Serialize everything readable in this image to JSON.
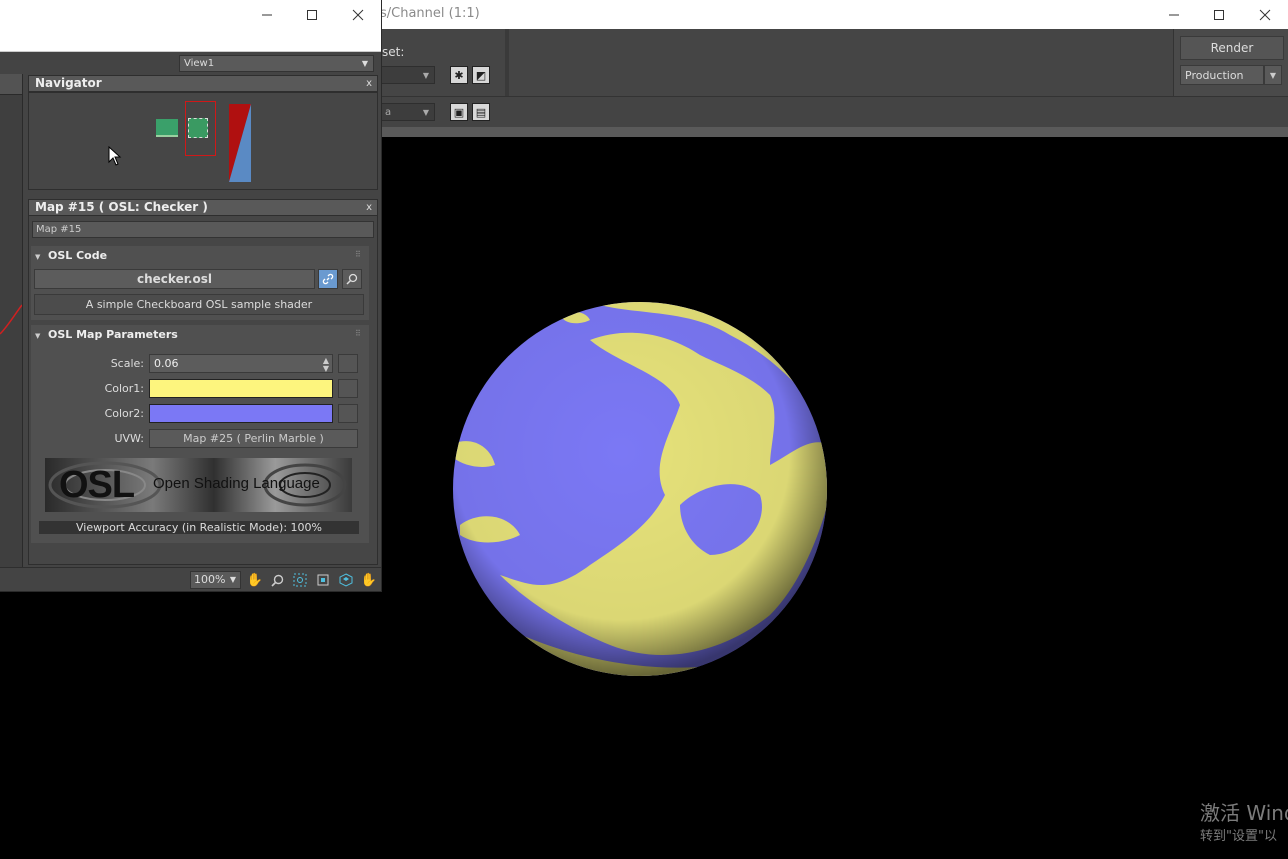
{
  "render_window": {
    "title_fragment": "s/Channel (1:1)",
    "preset_label": "set:",
    "render_label": "Render",
    "mode_value": "Production",
    "toolbar2_fragment": "a"
  },
  "watermark": {
    "line1": "激活 Wind",
    "line2": "转到\"设置\"以"
  },
  "slate": {
    "view_select": "View1",
    "navigator": {
      "title": "Navigator"
    },
    "map_panel": {
      "title": "Map #15  ( OSL: Checker )",
      "name_value": "Map #15",
      "osl_code": {
        "title": "OSL Code",
        "file": "checker.osl",
        "description": "A simple Checkboard OSL sample shader"
      },
      "params": {
        "title": "OSL Map Parameters",
        "scale_label": "Scale:",
        "scale_value": "0.06",
        "color1_label": "Color1:",
        "color1": "#fdf57e",
        "color2_label": "Color2:",
        "color2": "#7b78f5",
        "uvw_label": "UVW:",
        "uvw_value": "Map #25  ( Perlin Marble )"
      },
      "logo_text": "OSL",
      "logo_caption": "Open Shading Language",
      "accuracy": "Viewport Accuracy (in Realistic Mode): 100%"
    },
    "zoom": "100%"
  },
  "sphere_colors": {
    "base": "#7b78f5",
    "pattern": "#e6e27a"
  },
  "icons": [
    "minimize-icon",
    "maximize-icon",
    "close-icon",
    "pan-hand-icon",
    "zoom-icon",
    "zoom-region-icon",
    "zoom-extents-icon",
    "zoom-selected-icon",
    "pan-view-icon",
    "link-icon",
    "search-icon"
  ]
}
